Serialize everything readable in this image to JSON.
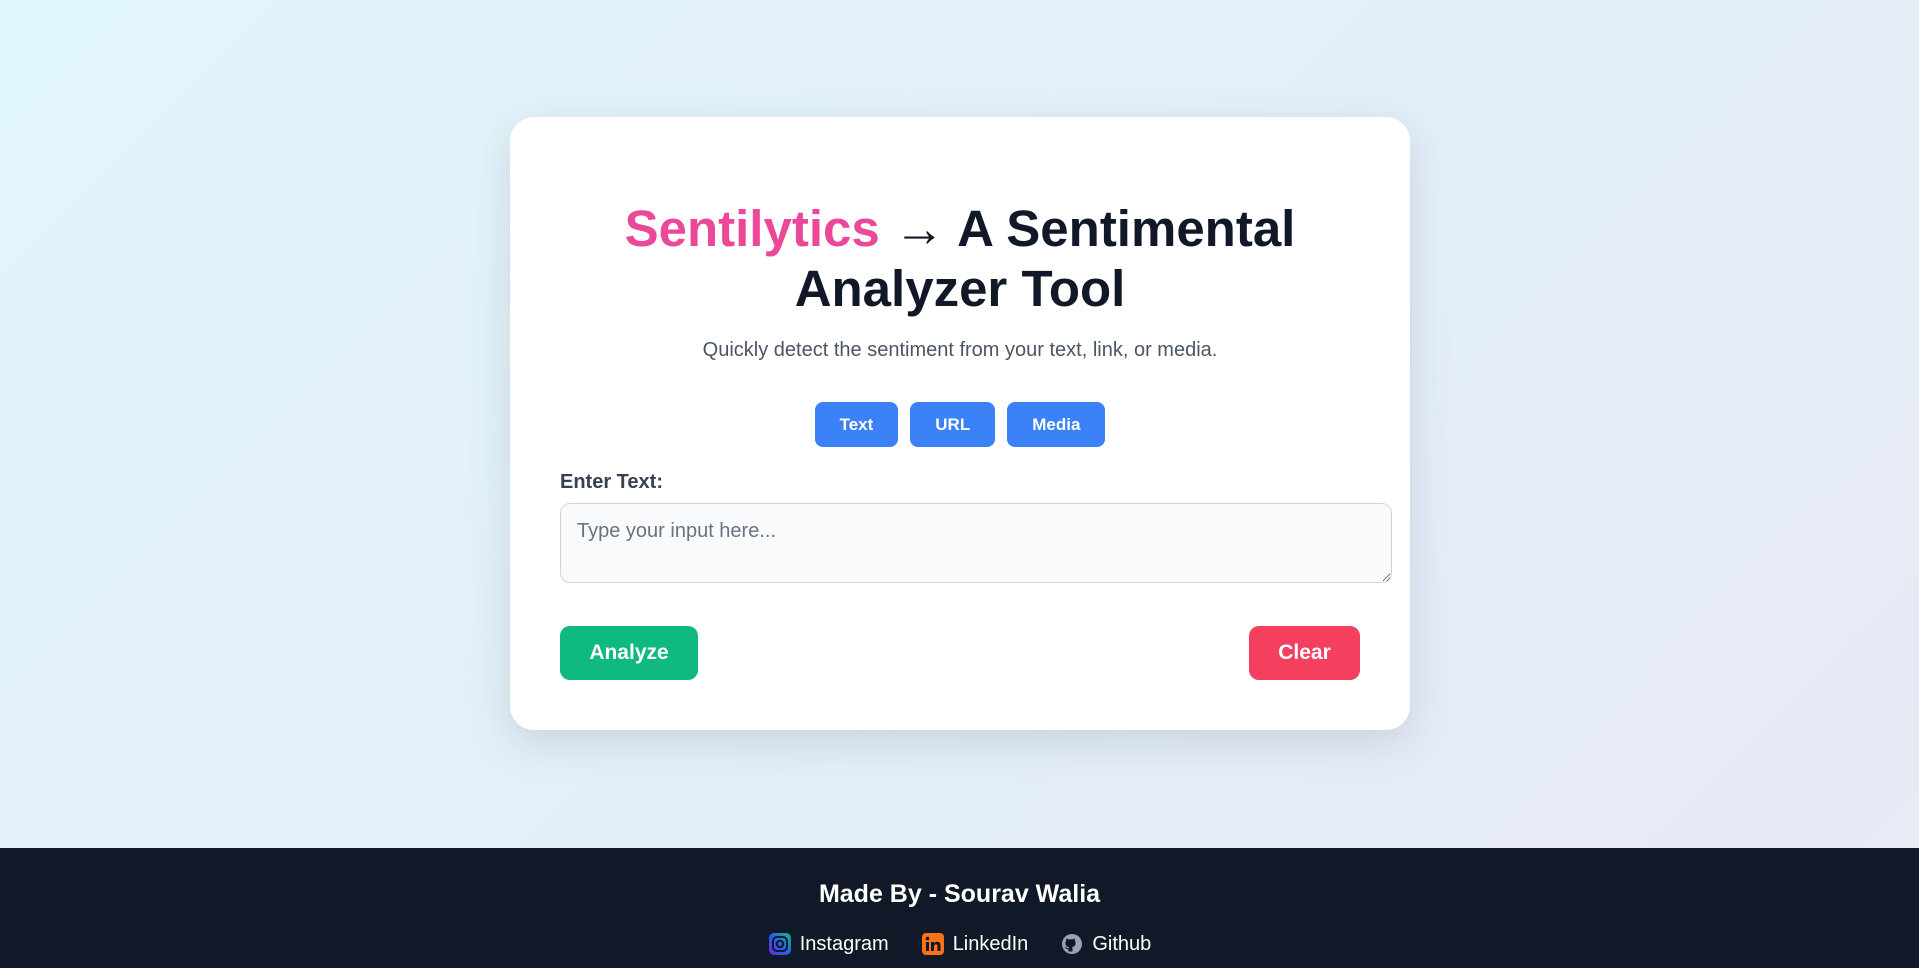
{
  "card": {
    "title_brand": "Sentilytics",
    "title_rest": " → A Sentimental Analyzer Tool",
    "subtitle": "Quickly detect the sentiment from your text, link, or media."
  },
  "tabs": [
    {
      "label": "Text"
    },
    {
      "label": "URL"
    },
    {
      "label": "Media"
    }
  ],
  "input": {
    "label": "Enter Text:",
    "placeholder": "Type your input here...",
    "value": ""
  },
  "actions": {
    "analyze_label": "Analyze",
    "clear_label": "Clear"
  },
  "footer": {
    "title": "Made By - Sourav Walia",
    "links": [
      {
        "label": "Instagram",
        "icon": "instagram-icon"
      },
      {
        "label": "LinkedIn",
        "icon": "linkedin-icon"
      },
      {
        "label": "Github",
        "icon": "github-icon"
      }
    ]
  },
  "colors": {
    "brand": "#ec4899",
    "tab": "#3b82f6",
    "analyze": "#10b981",
    "clear": "#f43f5e",
    "footer_bg": "#111827"
  }
}
